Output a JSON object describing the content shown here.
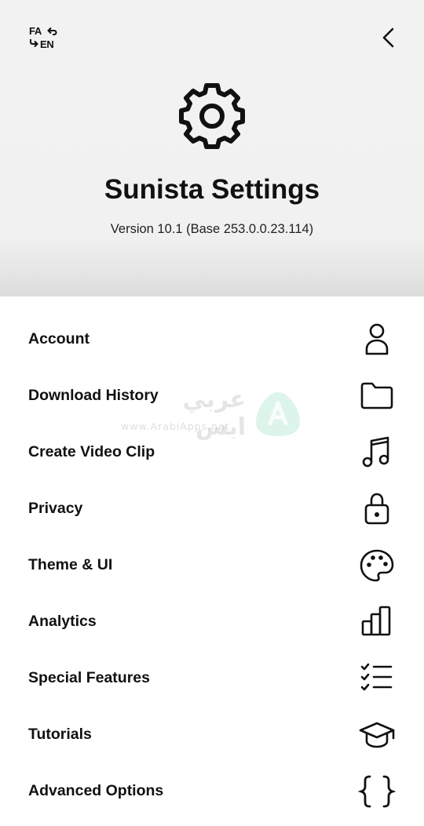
{
  "header": {
    "lang_from": "FA",
    "lang_to": "EN",
    "title": "Sunista Settings",
    "version": "Version 10.1 (Base 253.0.0.23.114)"
  },
  "menu": {
    "items": [
      {
        "label": "Account",
        "icon": "person-icon"
      },
      {
        "label": "Download History",
        "icon": "folder-icon"
      },
      {
        "label": "Create Video Clip",
        "icon": "music-note-icon"
      },
      {
        "label": "Privacy",
        "icon": "lock-icon"
      },
      {
        "label": "Theme & UI",
        "icon": "palette-icon"
      },
      {
        "label": "Analytics",
        "icon": "bar-chart-icon"
      },
      {
        "label": "Special Features",
        "icon": "checklist-icon"
      },
      {
        "label": "Tutorials",
        "icon": "graduation-cap-icon"
      },
      {
        "label": "Advanced Options",
        "icon": "curly-braces-icon"
      }
    ]
  },
  "watermark": {
    "arabic_text": "عربي ابس",
    "url": "www.ArabiApps.net"
  },
  "colors": {
    "header_bg": "#f1f1f1",
    "text": "#111111",
    "watermark_accent": "#bfe8d9"
  }
}
